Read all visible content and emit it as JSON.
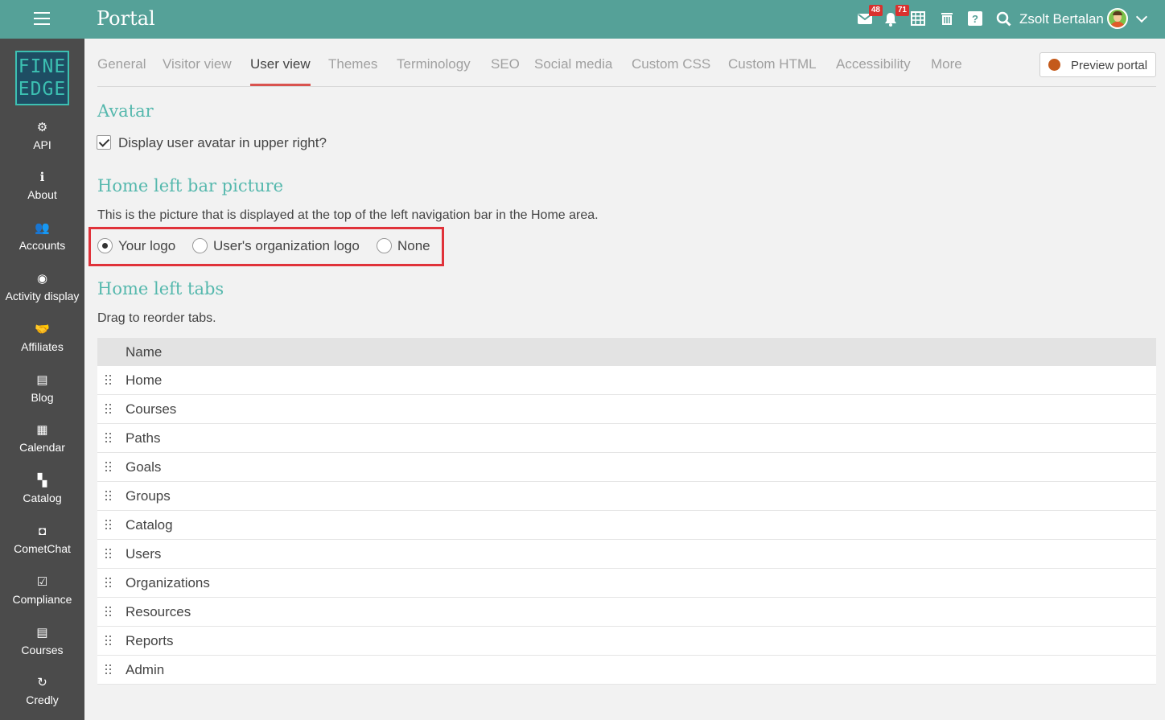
{
  "topbar": {
    "title": "Portal",
    "mail_badge": "48",
    "bell_badge": "71",
    "user_name": "Zsolt Bertalan"
  },
  "sidebar": {
    "logo_line1": "FINE",
    "logo_line2": "EDGE",
    "items": [
      {
        "label": "API",
        "icon": "gear-icon",
        "glyph": "⚙"
      },
      {
        "label": "About",
        "icon": "info-icon",
        "glyph": "ℹ"
      },
      {
        "label": "Accounts",
        "icon": "users-icon",
        "glyph": "👥"
      },
      {
        "label": "Activity display",
        "icon": "dot-circle-icon",
        "glyph": "◉"
      },
      {
        "label": "Affiliates",
        "icon": "handshake-icon",
        "glyph": "🤝"
      },
      {
        "label": "Blog",
        "icon": "blog-icon",
        "glyph": "▤"
      },
      {
        "label": "Calendar",
        "icon": "calendar-icon",
        "glyph": "▦"
      },
      {
        "label": "Catalog",
        "icon": "grid-icon",
        "glyph": "▚"
      },
      {
        "label": "CometChat",
        "icon": "cometchat-icon",
        "glyph": "◘"
      },
      {
        "label": "Compliance",
        "icon": "checklist-icon",
        "glyph": "☑"
      },
      {
        "label": "Courses",
        "icon": "courses-icon",
        "glyph": "▤"
      },
      {
        "label": "Credly",
        "icon": "credly-icon",
        "glyph": "↻"
      }
    ]
  },
  "tabs": [
    "General",
    "Visitor view",
    "User view",
    "Themes",
    "Terminology",
    "SEO",
    "Social media",
    "Custom CSS",
    "Custom HTML",
    "Accessibility",
    "More"
  ],
  "active_tab": "User view",
  "preview_button": "Preview portal",
  "avatar_section": {
    "title": "Avatar",
    "checkbox_label": "Display user avatar in upper right?",
    "checked": true
  },
  "left_bar_picture": {
    "title": "Home left bar picture",
    "description": "This is the picture that is displayed at the top of the left navigation bar in the Home area.",
    "options": [
      "Your logo",
      "User's organization logo",
      "None"
    ],
    "selected": "Your logo"
  },
  "left_tabs": {
    "title": "Home left tabs",
    "description": "Drag to reorder tabs.",
    "column_header": "Name",
    "rows": [
      "Home",
      "Courses",
      "Paths",
      "Goals",
      "Groups",
      "Catalog",
      "Users",
      "Organizations",
      "Resources",
      "Reports",
      "Admin"
    ]
  },
  "colors": {
    "topbar": "#55a198",
    "sidebar": "#4b4b4b",
    "section_title": "#55b8ad",
    "active_tab_underline": "#d9534f",
    "highlight_box": "#e0323a"
  }
}
